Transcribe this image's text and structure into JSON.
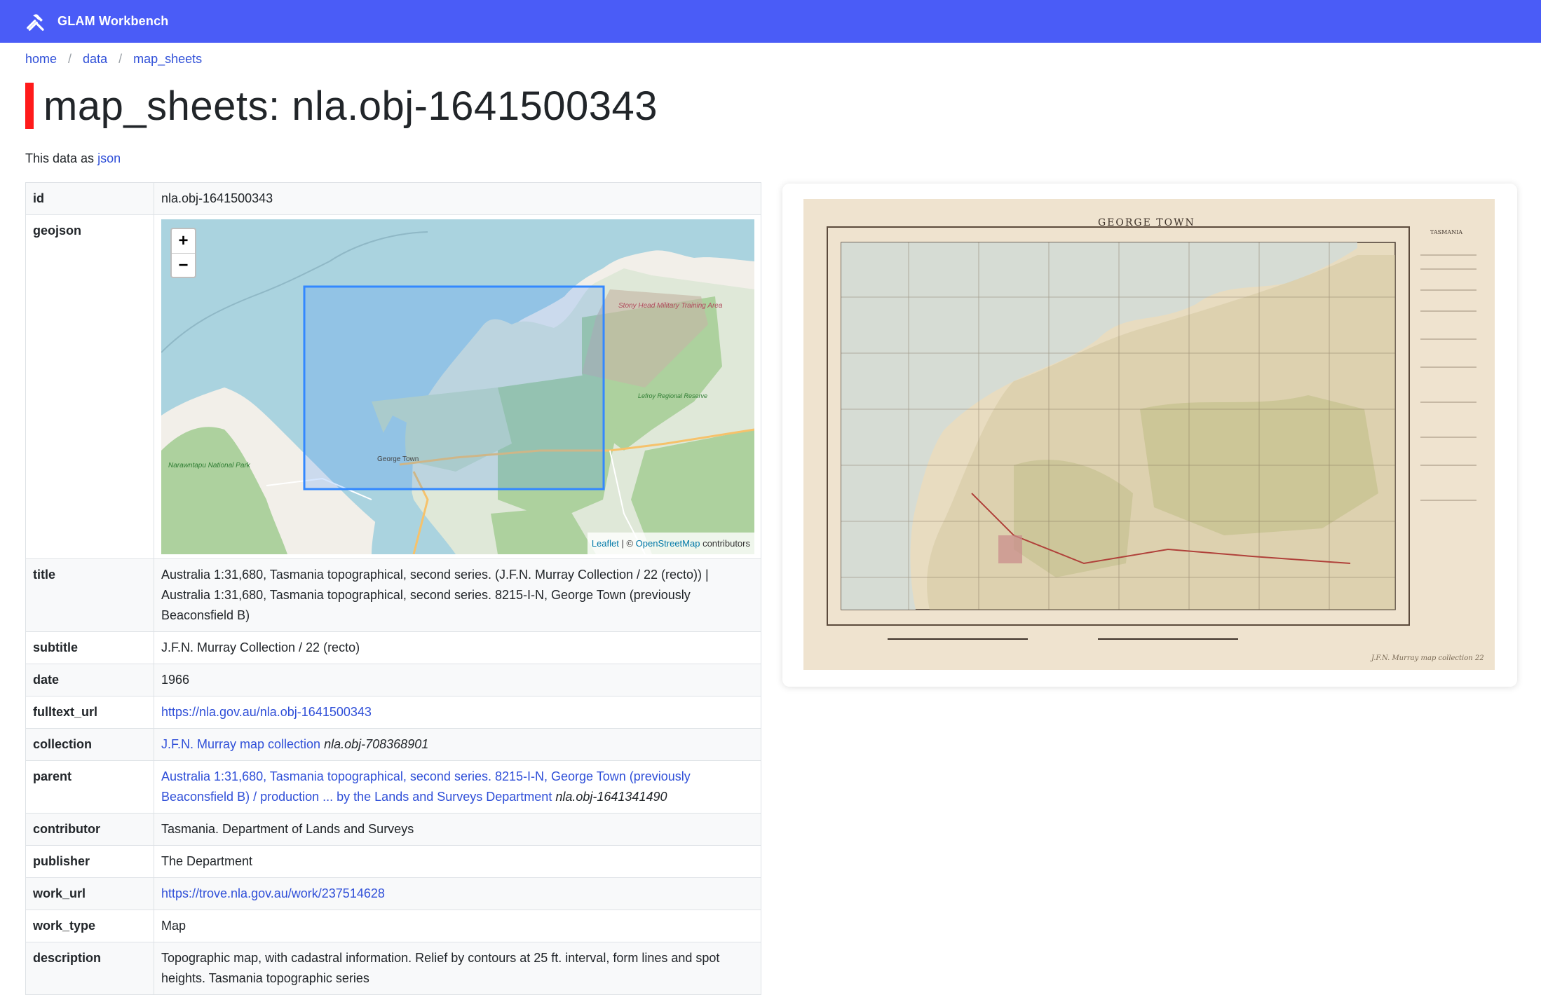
{
  "header": {
    "brand": "GLAM Workbench",
    "icon": "tools-icon",
    "color": "#4a5cf7"
  },
  "breadcrumb": {
    "items": [
      "home",
      "data",
      "map_sheets"
    ],
    "separator": "/"
  },
  "page": {
    "title": "map_sheets: nla.obj-1641500343",
    "accent_color": "#ff1a1a",
    "data_as_prefix": "This data as",
    "data_as_link": "json"
  },
  "record": {
    "id": {
      "key": "id",
      "value": "nla.obj-1641500343"
    },
    "geojson": {
      "key": "geojson"
    },
    "title": {
      "key": "title",
      "value": "Australia 1:31,680, Tasmania topographical, second series. (J.F.N. Murray Collection / 22 (recto)) | Australia 1:31,680, Tasmania topographical, second series. 8215-I-N, George Town (previously Beaconsfield B)"
    },
    "subtitle": {
      "key": "subtitle",
      "value": "J.F.N. Murray Collection / 22 (recto)"
    },
    "date": {
      "key": "date",
      "value": "1966"
    },
    "fulltext_url": {
      "key": "fulltext_url",
      "value": "https://nla.gov.au/nla.obj-1641500343"
    },
    "collection": {
      "key": "collection",
      "link": "J.F.N. Murray map collection",
      "id": "nla.obj-708368901"
    },
    "parent": {
      "key": "parent",
      "link": "Australia 1:31,680, Tasmania topographical, second series. 8215-I-N, George Town (previously Beaconsfield B) / production ... by the Lands and Surveys Department",
      "id": "nla.obj-1641341490"
    },
    "contributor": {
      "key": "contributor",
      "value": "Tasmania. Department of Lands and Surveys"
    },
    "publisher": {
      "key": "publisher",
      "value": "The Department"
    },
    "work_url": {
      "key": "work_url",
      "value": "https://trove.nla.gov.au/work/237514628"
    },
    "work_type": {
      "key": "work_type",
      "value": "Map"
    },
    "description": {
      "key": "description",
      "value": "Topographic map, with cadastral information. Relief by contours at 25 ft. interval, form lines and spot heights. Tasmania topographic series"
    }
  },
  "map": {
    "zoom_in": "+",
    "zoom_out": "−",
    "attribution_leaflet": "Leaflet",
    "attribution_sep": " | © ",
    "attribution_osm": "OpenStreetMap",
    "attribution_suffix": " contributors",
    "labels": {
      "military_area": "Stony Head Military Training Area",
      "park": "Narawntapu National Park",
      "town": "George Town",
      "lefroy": "Lefroy Regional Reserve"
    },
    "water_color": "#aad3df",
    "land_color": "#f2efe9",
    "forest_color": "#add19e",
    "bbox_color": "#3388ff"
  },
  "scan": {
    "heading": "GEORGE TOWN",
    "label_left": "TASMANIA",
    "signature": "J.F.N. Murray map collection 22"
  }
}
